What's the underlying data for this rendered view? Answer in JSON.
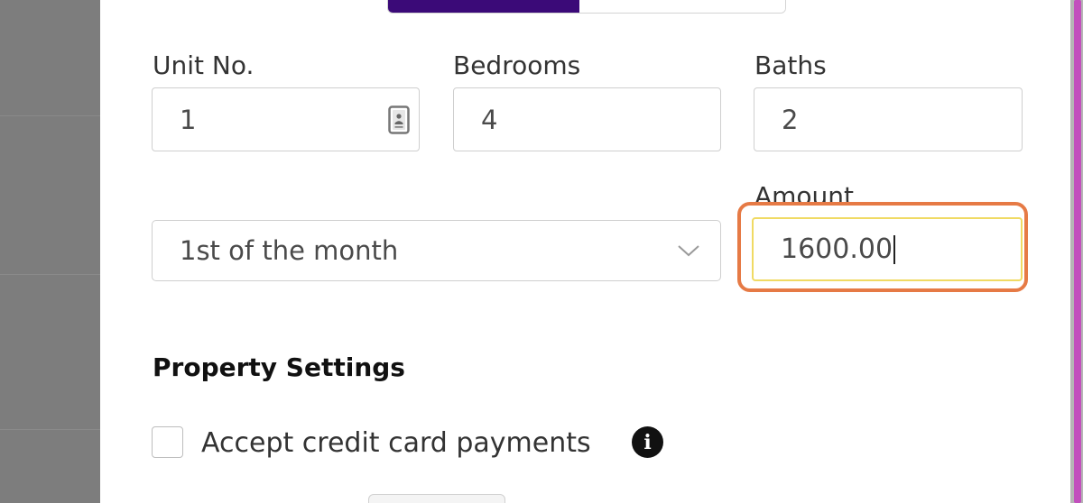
{
  "form": {
    "unit_no": {
      "label": "Unit No.",
      "value": "1"
    },
    "bedrooms": {
      "label": "Bedrooms",
      "value": "4"
    },
    "baths": {
      "label": "Baths",
      "value": "2"
    },
    "due_day": {
      "selected": "1st of the month"
    },
    "amount": {
      "label": "Amount",
      "value": "1600.00"
    }
  },
  "property_settings": {
    "heading": "Property Settings",
    "accept_credit_card": {
      "label": "Accept credit card payments",
      "checked": false
    },
    "info_icon_glyph": "i"
  },
  "icons": {
    "contact_card": "contact-card-icon",
    "chevron": "chevron-down-icon",
    "info": "info-icon"
  },
  "colors": {
    "tab_active": "#3b0a78",
    "highlight_ring": "#e67a45",
    "focus_border": "#f0da63",
    "scrollbar": "#c24fbd"
  }
}
